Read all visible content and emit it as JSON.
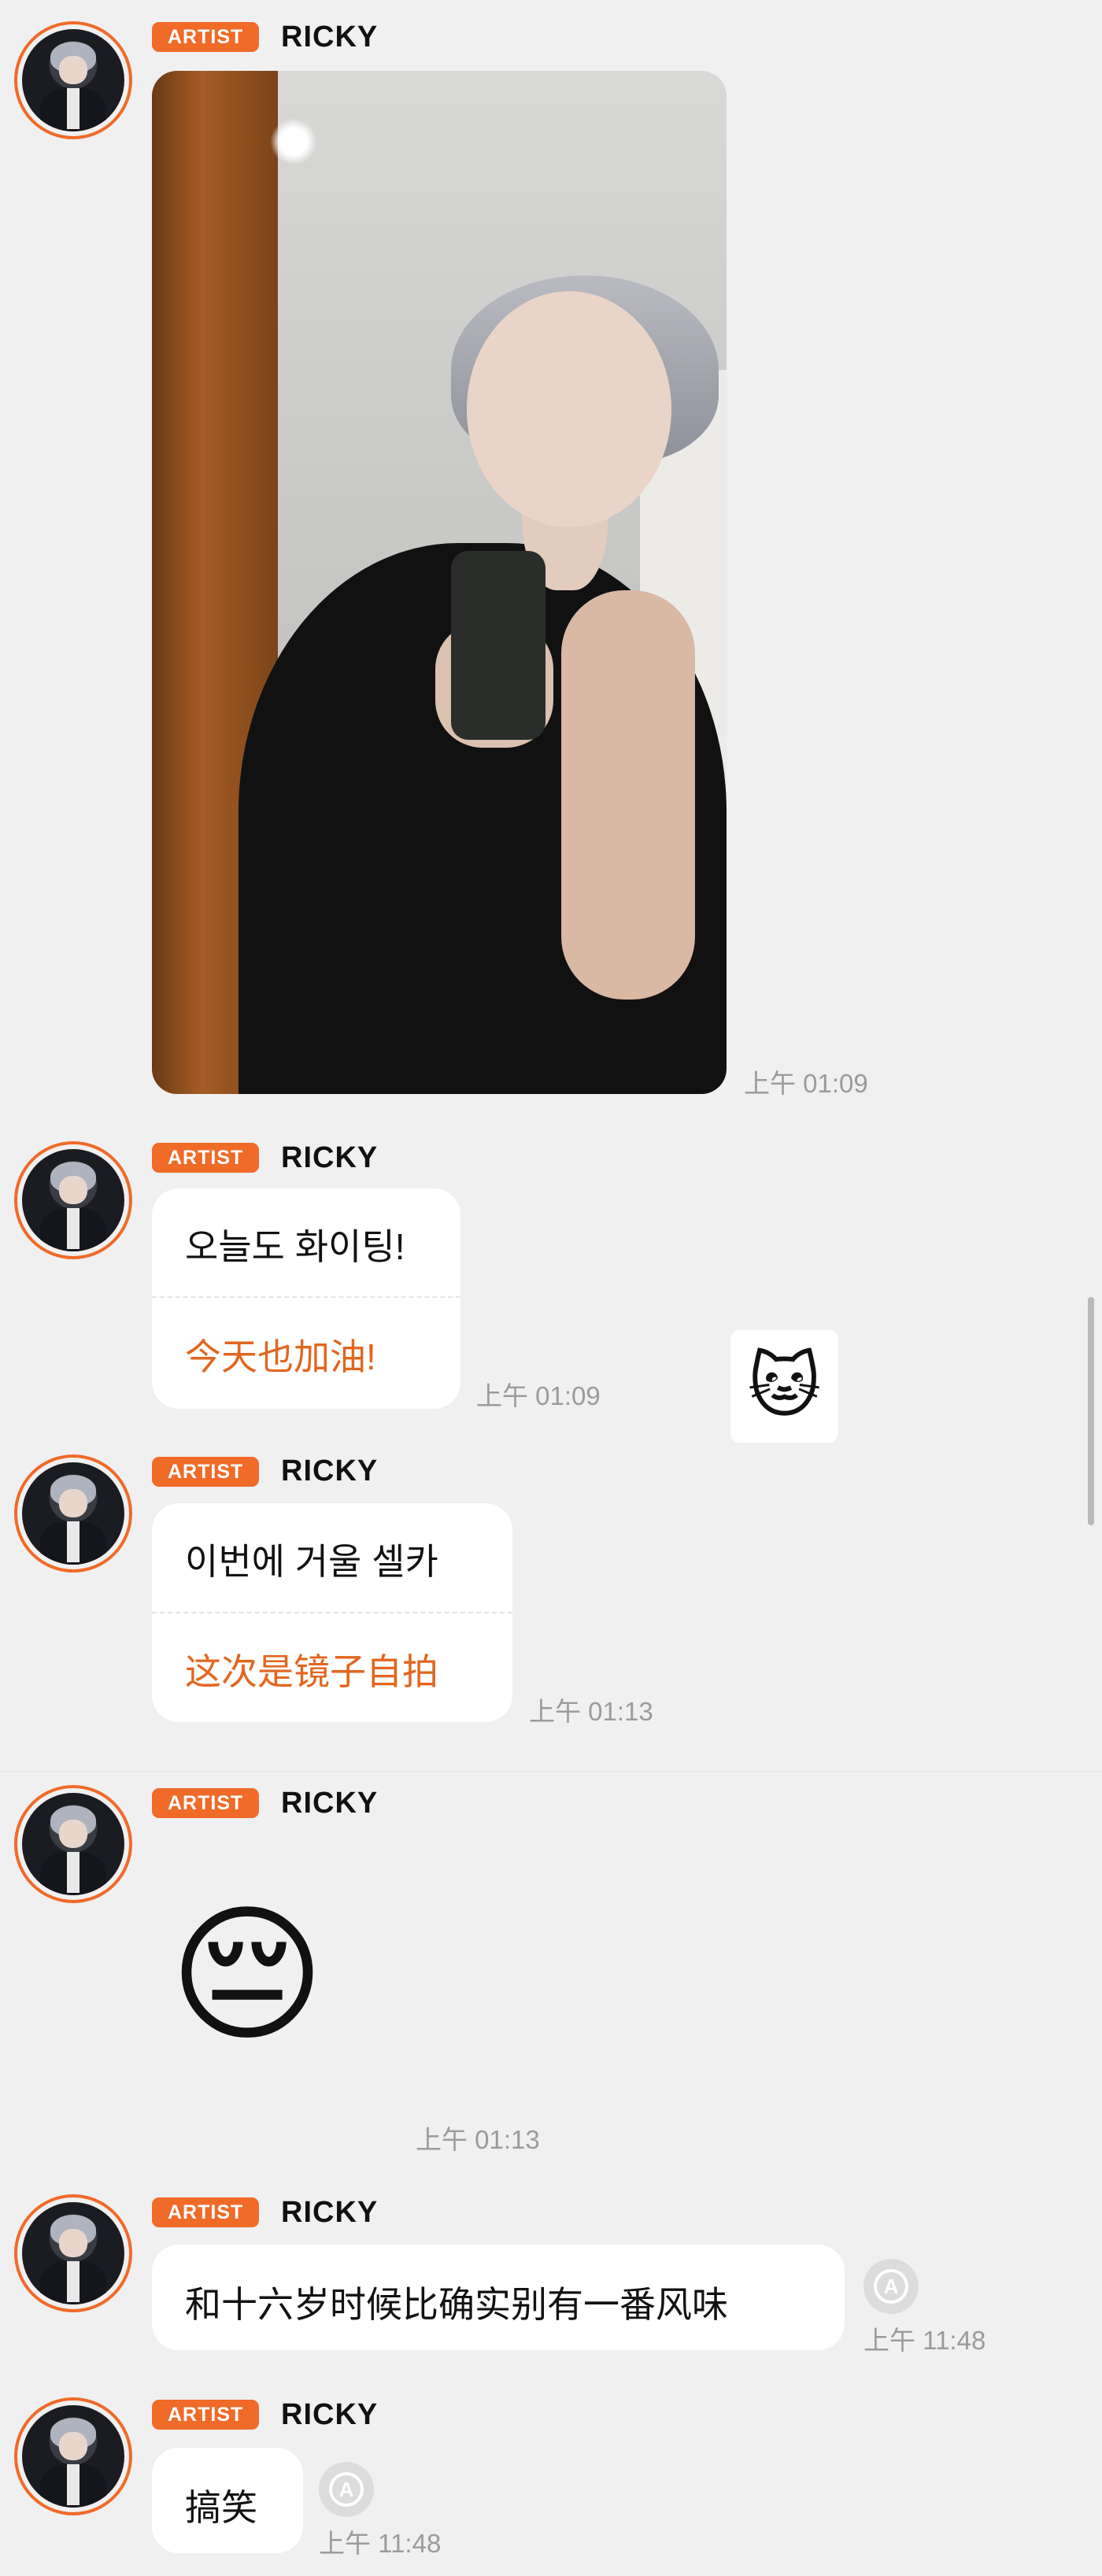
{
  "messages": [
    {
      "badge": "ARTIST",
      "sender": "RICKY",
      "type": "image",
      "time": "上午 01:09"
    },
    {
      "badge": "ARTIST",
      "sender": "RICKY",
      "type": "text",
      "original": "오늘도 화이팅!",
      "translation": "今天也加油!",
      "time": "上午 01:09",
      "reaction_sticker": "🐱"
    },
    {
      "badge": "ARTIST",
      "sender": "RICKY",
      "type": "text",
      "original": "이번에 거울 셀카",
      "translation": "这次是镜子自拍",
      "time": "上午 01:13"
    },
    {
      "badge": "ARTIST",
      "sender": "RICKY",
      "type": "emoji",
      "emoji": "😔",
      "time": "上午 01:13"
    },
    {
      "badge": "ARTIST",
      "sender": "RICKY",
      "type": "text",
      "original": "和十六岁时候比确实别有一番风味",
      "time": "上午 11:48",
      "translate_icon": "translate-icon"
    },
    {
      "badge": "ARTIST",
      "sender": "RICKY",
      "type": "text",
      "original": "搞笑",
      "time": "上午 11:48",
      "translate_icon": "translate-icon"
    }
  ],
  "colors": {
    "accent": "#f06a28",
    "translation_text": "#e2661f",
    "background": "#f0f0f0",
    "bubble": "#ffffff",
    "timestamp": "#9b9b9b"
  }
}
